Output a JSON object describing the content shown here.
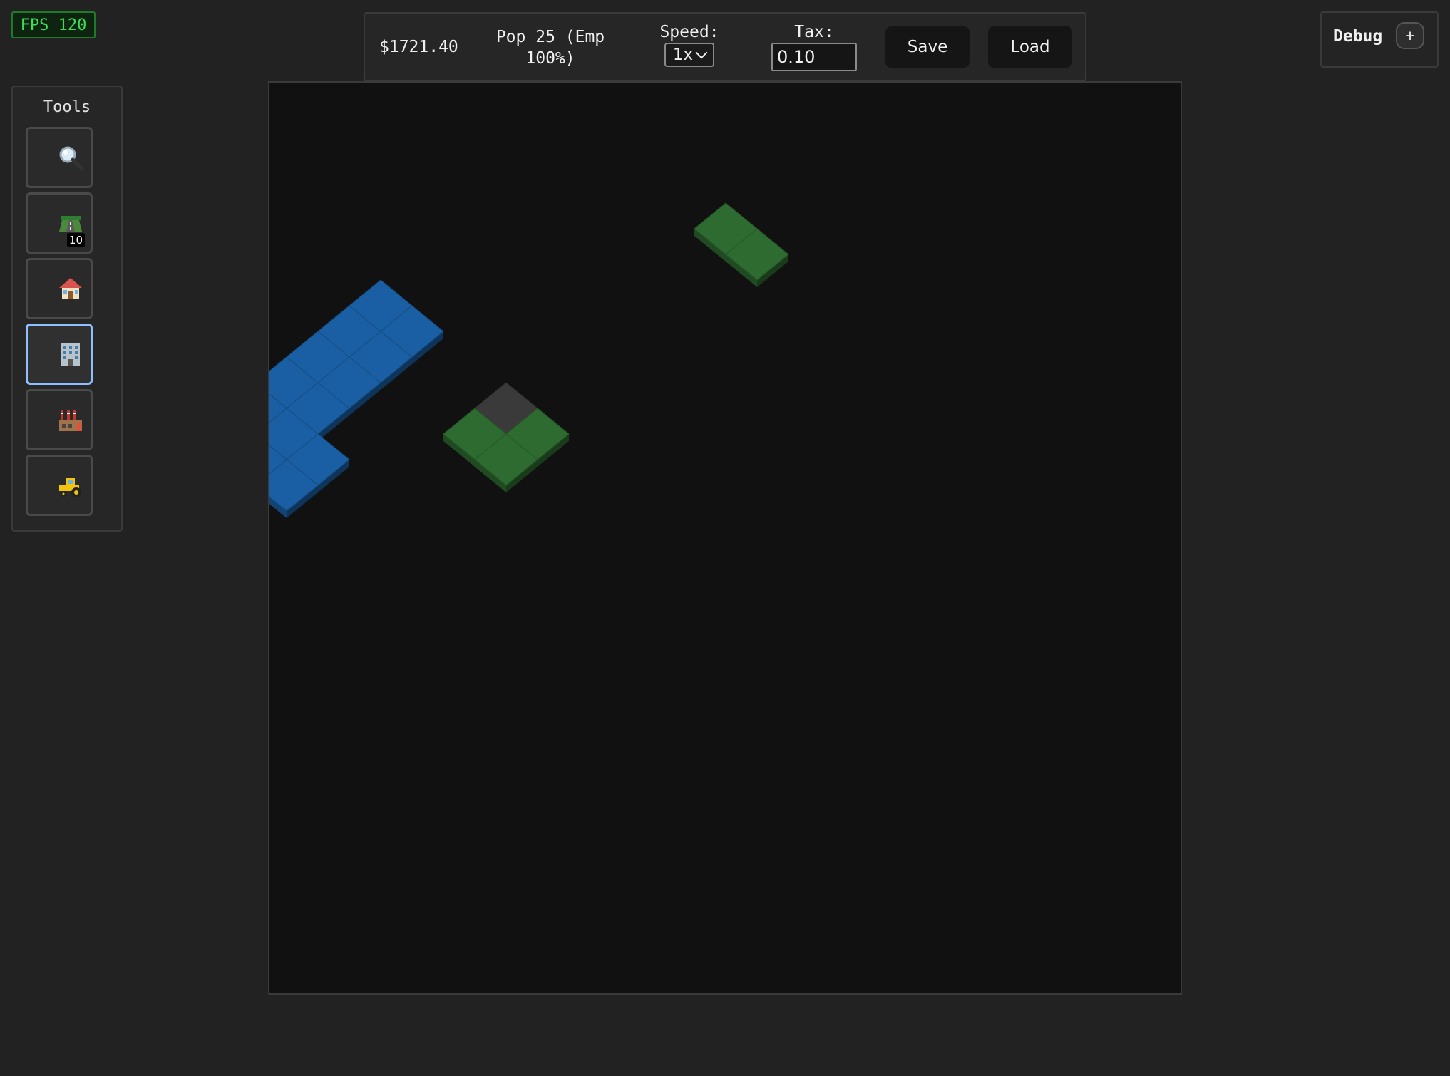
{
  "fps": {
    "label": "FPS 120"
  },
  "toolbar": {
    "money": "$1721.40",
    "population": "Pop 25 (Emp 100%)",
    "speed_label": "Speed:",
    "speed_value": "1x",
    "tax_label": "Tax:",
    "tax_value": "0.10",
    "save_label": "Save",
    "load_label": "Load"
  },
  "debug": {
    "title": "Debug",
    "expand_label": "+"
  },
  "tools": {
    "title": "Tools",
    "items": [
      {
        "name": "inspect",
        "icon": "magnifier-icon"
      },
      {
        "name": "road",
        "icon": "road-icon",
        "badge": "10"
      },
      {
        "name": "residential",
        "icon": "house-icon"
      },
      {
        "name": "commercial",
        "icon": "office-building-icon",
        "active": true
      },
      {
        "name": "industrial",
        "icon": "factory-icon"
      },
      {
        "name": "bulldoze",
        "icon": "tractor-icon"
      }
    ]
  },
  "map": {
    "colors": {
      "background": "#111111",
      "commercial": "#1a5fa3",
      "residential": "#2e6b30",
      "road": "#3a3a3a"
    },
    "tiles": [
      {
        "zone": "residential",
        "col": 0,
        "row": 0
      },
      {
        "zone": "residential",
        "col": 1,
        "row": 0
      },
      {
        "zone": "road",
        "col": 0,
        "row": 7
      },
      {
        "zone": "residential",
        "col": 0,
        "row": 8
      },
      {
        "zone": "residential",
        "col": 1,
        "row": 7
      },
      {
        "zone": "residential",
        "col": 1,
        "row": 8
      },
      {
        "zone": "commercial",
        "col": -4,
        "row": 7
      },
      {
        "zone": "commercial",
        "col": -3,
        "row": 7
      },
      {
        "zone": "commercial",
        "col": -4,
        "row": 8
      },
      {
        "zone": "commercial",
        "col": -3,
        "row": 8
      },
      {
        "zone": "commercial",
        "col": -4,
        "row": 9
      },
      {
        "zone": "commercial",
        "col": -3,
        "row": 9
      },
      {
        "zone": "commercial",
        "col": -4,
        "row": 10
      },
      {
        "zone": "commercial",
        "col": -3,
        "row": 10
      },
      {
        "zone": "commercial",
        "col": -4,
        "row": 11
      },
      {
        "zone": "commercial",
        "col": -3,
        "row": 11
      },
      {
        "zone": "commercial",
        "col": -4,
        "row": 12
      },
      {
        "zone": "commercial",
        "col": -3,
        "row": 12
      },
      {
        "zone": "commercial",
        "col": -2,
        "row": 11
      },
      {
        "zone": "commercial",
        "col": -2,
        "row": 12
      }
    ]
  }
}
